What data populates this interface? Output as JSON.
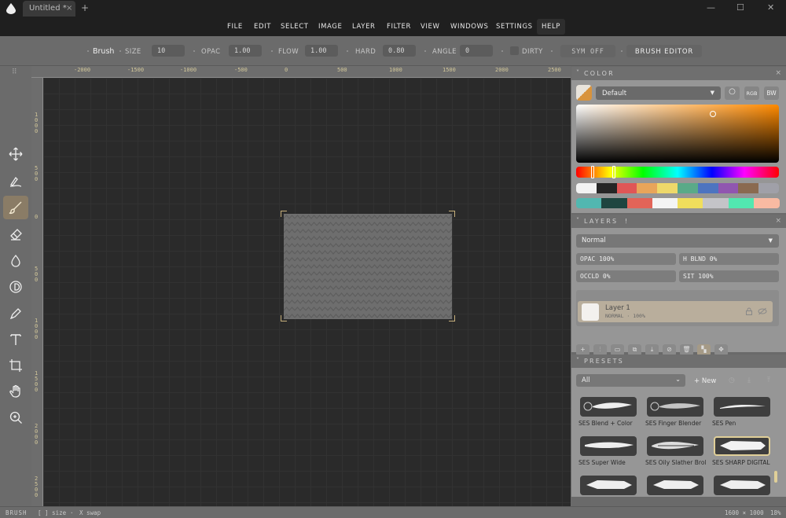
{
  "window": {
    "tab_title": "Untitled *",
    "tab_close": "×",
    "tab_add": "+",
    "minimize": "—",
    "maximize": "☐",
    "close": "✕"
  },
  "menu": [
    "FILE",
    "EDIT",
    "SELECT",
    "IMAGE",
    "LAYER",
    "FILTER",
    "VIEW",
    "WINDOWS",
    "SETTINGS",
    "HELP"
  ],
  "options": {
    "tool_name": "Brush",
    "size_label": "SIZE",
    "size_value": "10",
    "opac_label": "OPAC",
    "opac_value": "1.00",
    "flow_label": "FLOW",
    "flow_value": "1.00",
    "hard_label": "HARD",
    "hard_value": "0.80",
    "angle_label": "ANGLE",
    "angle_value": "0",
    "dirty_label": "DIRTY",
    "sym_label": "SYM OFF",
    "brush_editor_label": "BRUSH EDITOR"
  },
  "toolbar": {
    "grip": "⠿",
    "tools": [
      "move",
      "smudge",
      "brush",
      "eraser",
      "fill",
      "dodge",
      "pen",
      "text",
      "crop",
      "hand",
      "zoom"
    ],
    "active_tool": "brush"
  },
  "rulers": {
    "top": [
      "-2000",
      "-1500",
      "-1000",
      "-500",
      "0",
      "500",
      "1000",
      "1500",
      "2000",
      "2500"
    ],
    "left": [
      "1000",
      "500",
      "0",
      "500",
      "1000",
      "1500",
      "2000",
      "2500"
    ]
  },
  "status": {
    "mode": "BRUSH",
    "hint1": "[ ] size",
    "separator": "·",
    "hint2": "X swap",
    "doc_size": "1600 × 1000",
    "zoom": "18%"
  },
  "color_panel": {
    "title": "COLOR",
    "chevron": "˅",
    "close": "×",
    "palette_name": "Default",
    "dropdown_arrow": "▼",
    "mode_circle": "○",
    "mode_rgb": "RGB",
    "mode_bw": "BW",
    "swatches_row1": [
      "#f2f2f2",
      "#262626",
      "#e05656",
      "#e8a55a",
      "#eed86a",
      "#5aaa88",
      "#4d74c0",
      "#9056b0",
      "#8a6a50",
      "#a0a0a8"
    ],
    "swatches_row2": [
      "#52b7b0",
      "#1f4540",
      "#e26458",
      "#f4f4f4",
      "#f0de5c",
      "#c4c4c8",
      "#52e8b0",
      "#f8baa2"
    ]
  },
  "layers_panel": {
    "title": "LAYERS",
    "badge": "!",
    "chevron": "˅",
    "close": "×",
    "blend_mode": "Normal",
    "dropdown_arrow": "▼",
    "opac": "OPAC 100%",
    "h_blnd": "H BLND 0%",
    "occld": "OCCLD 0%",
    "sit": "SIT 100%",
    "layer_name": "Layer 1",
    "layer_meta": "NORMAL · 100%",
    "buttons": [
      "+",
      "⫶",
      "▭",
      "⧉",
      "⤓",
      "⊘",
      "🗑",
      "▚",
      "✥"
    ]
  },
  "presets_panel": {
    "title": "PRESETS",
    "chevron": "˅",
    "filter": "All",
    "filter_arrow": "⌄",
    "new_label": "+ New",
    "icons": [
      "◷",
      "⤓",
      "⤒"
    ],
    "presets": [
      "SES Blend + Color",
      "SES Finger Blender",
      "SES Pen",
      "SES Super Wide",
      "SES Oily Slather Brol",
      "SES SHARP DIGITAL",
      "",
      "",
      ""
    ],
    "selected_preset": "SES SHARP DIGITAL"
  }
}
